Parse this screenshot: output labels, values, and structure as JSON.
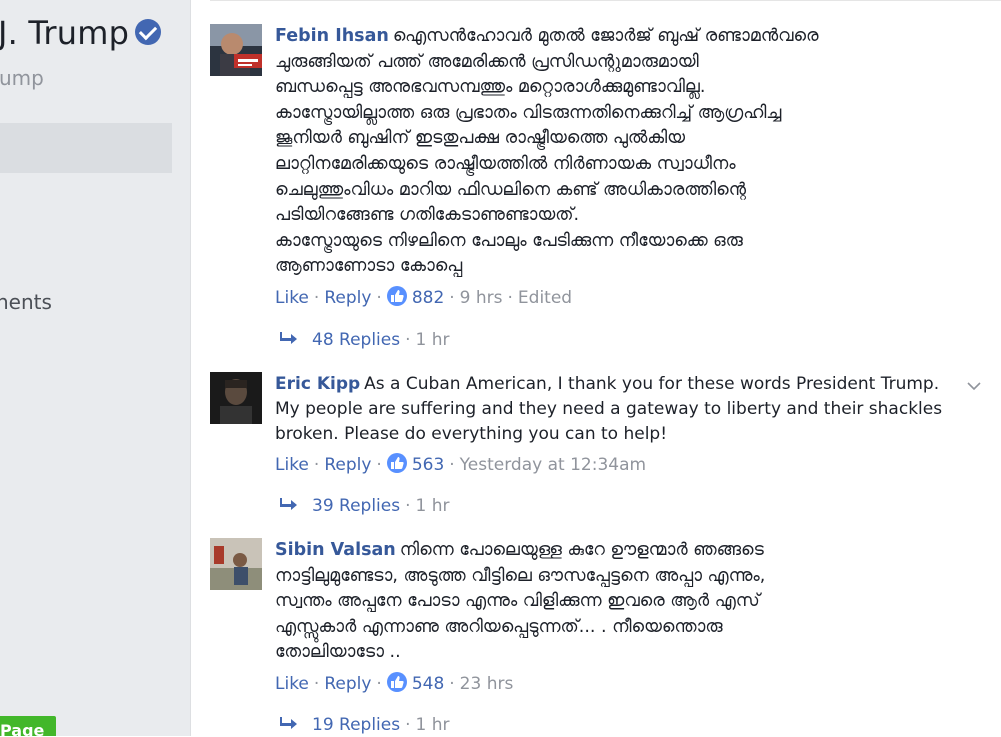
{
  "sidebar": {
    "page_name": "J. Trump",
    "page_handle": "ump",
    "nav_item": "nents",
    "create_page_label": "Page"
  },
  "comments": [
    {
      "author": "Febin Ihsan",
      "lines": [
        "ഐസൻഹോവർ  മുതൽ  ജോർജ് ബുഷ് രണ്ടാമൻവരെ",
        "ചുരുങ്ങിയത് പത്ത് അമേരിക്കൻ  പ്രസിഡന്റുമാരുമായി",
        "ബന്ധപ്പെട്ട അനുഭവസമ്പത്തും മറ്റൊരാൾക്കുമുണ്ടാവില്ല.",
        "കാസ്ട്രോയില്ലാത്ത ഒരു പ്രഭാതം വിടരുന്നതിനെക്കുറിച്ച് ആഗ്രഹിച്ച",
        "ജൂനിയർ  ബുഷിന് ഇടതുപക്ഷ രാഷ്ട്രീയത്തെ പുൽകിയ",
        "ലാറ്റിനമേരിക്കയുടെ രാഷ്ട്രീയത്തിൽ  നിർണായക സ്വാധീനം",
        "ചെലുത്തുംവിധം മാറിയ ഫിഡലിനെ കണ്ട് അധികാരത്തിന്റെ",
        "പടിയിറങ്ങേണ്ട ഗതികേടാണുണ്ടായത്.",
        "കാസ്ട്രോയുടെ നിഴലിനെ പോലും പേടിക്കുന്ന നീയോക്കെ ഒരു",
        "ആണാണോടാ കോപ്പെ"
      ],
      "like_label": "Like",
      "reply_label": "Reply",
      "like_count": "882",
      "time": "9 hrs",
      "edited": "Edited",
      "replies_label": "48 Replies",
      "replies_time": "1 hr"
    },
    {
      "author": "Eric Kipp",
      "lines": [
        "As a Cuban American, I thank you for these words President Trump.",
        "My people are suffering and they need a gateway to liberty and their shackles",
        "broken. Please do everything you can to help!"
      ],
      "like_label": "Like",
      "reply_label": "Reply",
      "like_count": "563",
      "time": "Yesterday at 12:34am",
      "replies_label": "39 Replies",
      "replies_time": "1 hr"
    },
    {
      "author": "Sibin Valsan",
      "lines": [
        "നിന്നെ പോലെയുള്ള കുറേ ഊളന്മാർ ഞങ്ങടെ",
        "നാട്ടിലുമുണ്ടേടാ, അടുത്ത വീട്ടിലെ ഔസപ്പേട്ടനെ അപ്പാ എന്നും,",
        "സ്വന്തം അപ്പനേ പോടാ എന്നും വിളിക്കുന്ന ഇവരെ ആർ എസ്",
        "എസ്സുകാർ എന്നാണു അറിയപ്പെടുന്നത്... . നീയെന്തൊരു",
        "തോലിയാടോ .."
      ],
      "like_label": "Like",
      "reply_label": "Reply",
      "like_count": "548",
      "time": "23 hrs",
      "replies_label": "19 Replies",
      "replies_time": "1 hr"
    }
  ],
  "colors": {
    "link": "#365899",
    "action": "#4267b2",
    "muted": "#90949c",
    "like_badge": "#5890ff",
    "create_page": "#42b72a",
    "sidebar_bg": "#e9ebee"
  }
}
